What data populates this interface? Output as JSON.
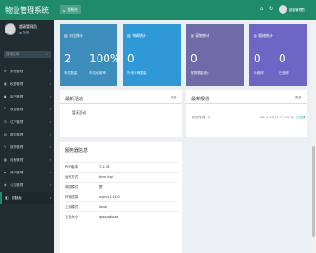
{
  "app": {
    "title": "物业管理系统"
  },
  "user": {
    "name": "超级管理员",
    "status": "在线"
  },
  "search": {
    "placeholder": "搜索菜单"
  },
  "sidebar": {
    "items": [
      {
        "label": "系统管理",
        "icon": "gear-icon",
        "glyph": "⚙"
      },
      {
        "label": "权限管理",
        "icon": "lock-icon",
        "glyph": "▣"
      },
      {
        "label": "用户管理",
        "icon": "user-icon",
        "glyph": "●"
      },
      {
        "label": "收费管理",
        "icon": "money-icon",
        "glyph": "¥"
      },
      {
        "label": "住户管理",
        "icon": "users-icon",
        "glyph": "☰"
      },
      {
        "label": "楼宇管理",
        "icon": "building-icon",
        "glyph": "▤"
      },
      {
        "label": "报修管理",
        "icon": "wrench-icon",
        "glyph": "✎"
      },
      {
        "label": "设备管理",
        "icon": "device-icon",
        "glyph": "▦"
      },
      {
        "label": "资产管理",
        "icon": "asset-icon",
        "glyph": "◆"
      },
      {
        "label": "公告管理",
        "icon": "bell-icon",
        "glyph": "◉"
      },
      {
        "label": "控制台",
        "icon": "dashboard-icon",
        "glyph": "◧"
      }
    ]
  },
  "topbar": {
    "tab_label": "控制台",
    "username": "超级管理员"
  },
  "cards": [
    {
      "title": "车位统计",
      "color": "#3c8dbc",
      "stats": [
        {
          "value": "2",
          "label": "车位数量"
        },
        {
          "value": "100%",
          "label": "车位使用率"
        }
      ]
    },
    {
      "title": "车辆统计",
      "color": "#2f98d7",
      "stats": [
        {
          "value": "0",
          "label": "外来车辆数量"
        }
      ]
    },
    {
      "title": "宠物统计",
      "color": "#6f6aa8",
      "stats": [
        {
          "value": "0",
          "label": "宠物数量统计"
        }
      ]
    },
    {
      "title": "报修统计",
      "color": "#6e66c5",
      "stats": [
        {
          "value": "0",
          "label": "待维修"
        },
        {
          "value": "0",
          "label": "已维修"
        }
      ]
    }
  ],
  "activity": {
    "title": "最新活动",
    "more": "更多",
    "items": [
      "暂无活动"
    ]
  },
  "repairs": {
    "title": "最新报修",
    "more": "更多",
    "items": [
      {
        "name": "报修管理（ ）",
        "date": "2019-11-17 17:12:09",
        "status": "已完成"
      }
    ]
  },
  "server": {
    "title": "服务器信息",
    "rows": [
      {
        "key": "PHP版本",
        "value": "7.2.18"
      },
      {
        "key": "运行方式",
        "value": "fpm-fcgi"
      },
      {
        "key": "调试模式",
        "value": "是"
      },
      {
        "key": "环境信息",
        "value": "nginx/1.18.0"
      },
      {
        "key": "上传模式",
        "value": "local"
      },
      {
        "key": "上传大小",
        "value": "ajax/upload"
      }
    ]
  }
}
